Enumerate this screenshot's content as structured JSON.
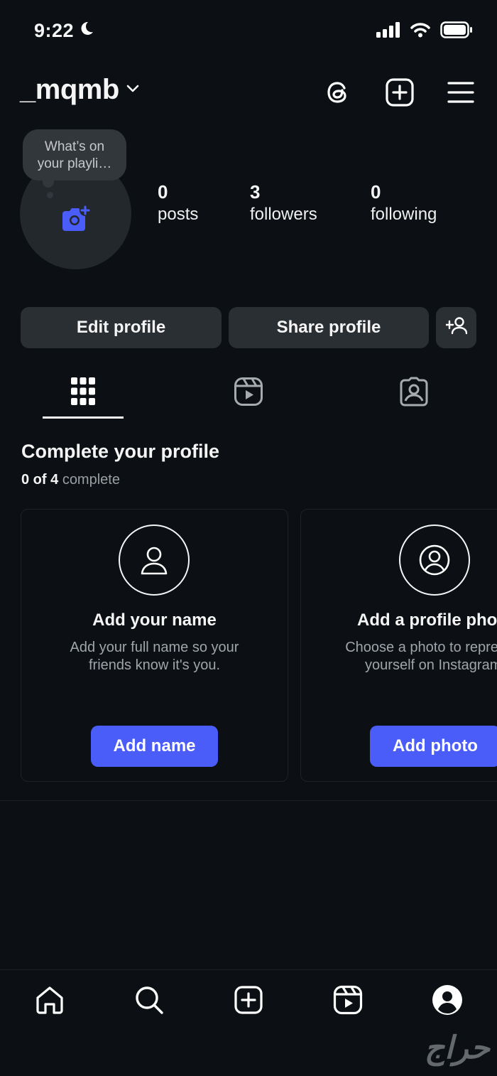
{
  "status_bar": {
    "time": "9:22"
  },
  "header": {
    "username": "_mqmb"
  },
  "profile": {
    "note": "What’s on your playli…",
    "stats": [
      {
        "value": "0",
        "label": "posts"
      },
      {
        "value": "3",
        "label": "followers"
      },
      {
        "value": "0",
        "label": "following"
      }
    ]
  },
  "actions": {
    "edit_label": "Edit profile",
    "share_label": "Share profile"
  },
  "complete_profile": {
    "title": "Complete your profile",
    "progress_done": "0 of 4",
    "progress_suffix": "complete",
    "cards": [
      {
        "title": "Add your name",
        "desc_line1": "Add your full name so your",
        "desc_line2": "friends know it's you.",
        "button": "Add name"
      },
      {
        "title": "Add a profile photo",
        "desc_line1": "Choose a photo to represent",
        "desc_line2": "yourself on Instagram.",
        "button": "Add photo"
      }
    ]
  },
  "watermark": "حراج",
  "colors": {
    "background": "#0c1014",
    "accent": "#4a5df9",
    "button_bg": "#2a2f34"
  },
  "icons": {
    "header": [
      "threads-icon",
      "create-icon",
      "menu-icon"
    ],
    "tabs": [
      "grid-icon",
      "reels-icon",
      "tagged-icon"
    ],
    "nav": [
      "home-icon",
      "search-icon",
      "create-icon",
      "reels-icon",
      "profile-icon"
    ]
  }
}
